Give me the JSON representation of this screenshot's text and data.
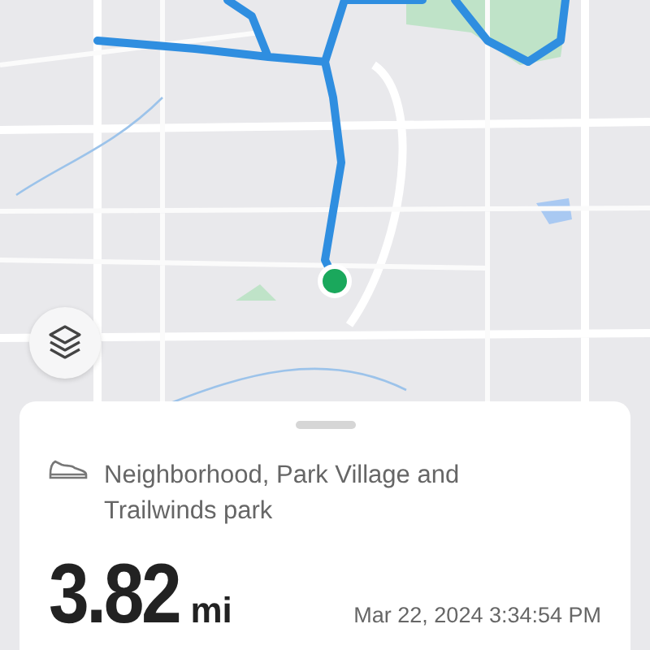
{
  "layers_button": {
    "kind": "layers"
  },
  "activity": {
    "kind": "walk",
    "title": "Neighborhood, Park Village and Trailwinds park",
    "distance": "3.82",
    "unit": "mi",
    "date": "Mar 22, 2024 3:34:54 PM"
  }
}
